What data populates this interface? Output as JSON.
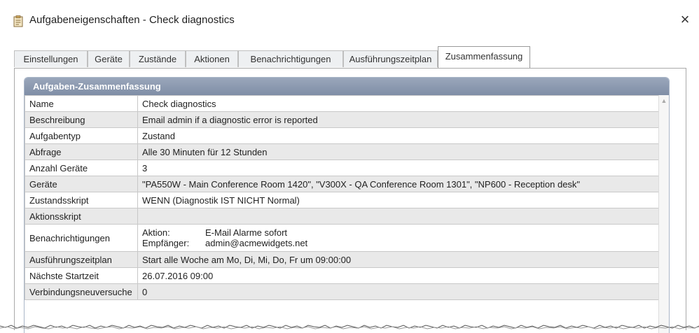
{
  "window": {
    "title": "Aufgabeneigenschaften - Check diagnostics",
    "close_label": "×"
  },
  "tabs": [
    {
      "label": "Einstellungen"
    },
    {
      "label": "Geräte"
    },
    {
      "label": "Zustände"
    },
    {
      "label": "Aktionen"
    },
    {
      "label": "Benachrichtigungen"
    },
    {
      "label": "Ausführungszeitplan"
    },
    {
      "label": "Zusammenfassung",
      "active": true
    }
  ],
  "summary": {
    "header": "Aufgaben-Zusammenfassung",
    "rows": [
      {
        "key": "Name",
        "value": "Check diagnostics"
      },
      {
        "key": "Beschreibung",
        "value": "Email admin if a diagnostic error is reported"
      },
      {
        "key": "Aufgabentyp",
        "value": "Zustand"
      },
      {
        "key": "Abfrage",
        "value": "Alle 30 Minuten für 12 Stunden"
      },
      {
        "key": "Anzahl Geräte",
        "value": "3"
      },
      {
        "key": "Geräte",
        "value": "\"PA550W - Main Conference Room 1420\", \"V300X - QA Conference Room 1301\", \"NP600 - Reception desk\""
      },
      {
        "key": "Zustandsskript",
        "value": "WENN (Diagnostik IST NICHT Normal)"
      },
      {
        "key": "Aktionsskript",
        "value": ""
      },
      {
        "key": "Benachrichtigungen",
        "notify": {
          "action_label": "Aktion:",
          "action_value": "E-Mail Alarme sofort",
          "recipient_label": "Empfänger:",
          "recipient_value": "admin@acmewidgets.net"
        }
      },
      {
        "key": "Ausführungszeitplan",
        "value": "Start alle Woche am Mo, Di, Mi, Do, Fr um 09:00:00"
      },
      {
        "key": "Nächste Startzeit",
        "value": "26.07.2016 09:00"
      },
      {
        "key": "Verbindungsneuversuche",
        "value": "0"
      }
    ]
  }
}
